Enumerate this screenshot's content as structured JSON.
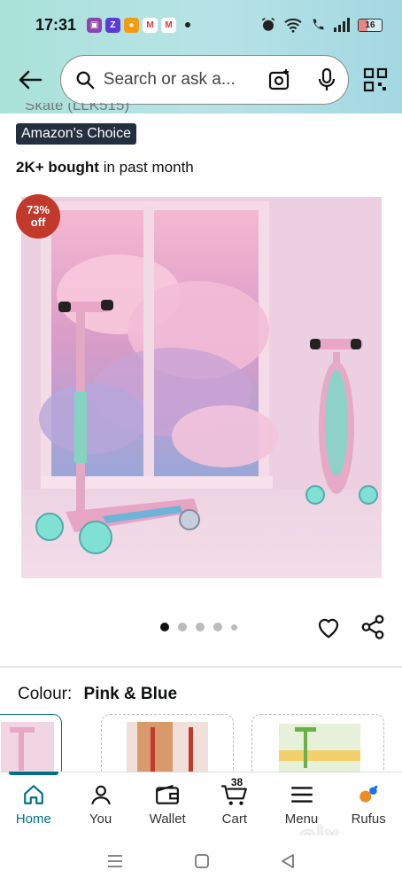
{
  "status": {
    "time": "17:31",
    "battery": "16",
    "notif_letters": [
      "Z",
      "M",
      "M"
    ]
  },
  "header": {
    "search_placeholder": "Search or ask a..."
  },
  "product": {
    "title_cut": "Skate (LLK515)",
    "choice_badge": "Amazon's Choice",
    "bought_bold": "2K+ bought",
    "bought_rest": " in past month",
    "discount_pct": "73%",
    "discount_word": "off",
    "image_count": 5,
    "active_image": 0
  },
  "colour": {
    "label": "Colour:",
    "value": "Pink & Blue"
  },
  "bottom_nav": {
    "items": [
      {
        "label": "Home",
        "icon": "home-icon"
      },
      {
        "label": "You",
        "icon": "user-icon"
      },
      {
        "label": "Wallet",
        "icon": "wallet-icon"
      },
      {
        "label": "Cart",
        "icon": "cart-icon"
      },
      {
        "label": "Menu",
        "icon": "menu-icon"
      },
      {
        "label": "Rufus",
        "icon": "rufus-icon"
      }
    ],
    "cart_count": "38",
    "active": "Home"
  },
  "watermark": "olx",
  "colors": {
    "accent": "#007185",
    "badge_bg": "#232f3e",
    "discount_bg": "#c0392b",
    "header_gradient": "#a9e2d9"
  }
}
